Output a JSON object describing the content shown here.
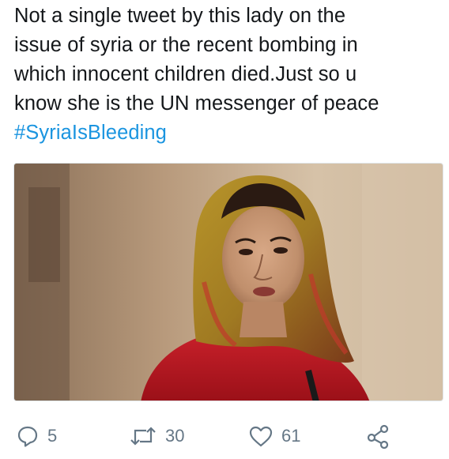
{
  "tweet": {
    "text_lines": [
      "Not a single tweet by this lady on the",
      "issue of syria or the recent bombing in",
      "which innocent children died.Just so u",
      "know she is the UN messenger of peace"
    ],
    "hashtag": "#SyriaIsBleeding"
  },
  "media": {
    "description_icon": "photo"
  },
  "actions": {
    "reply": {
      "icon": "reply-icon",
      "count": "5"
    },
    "retweet": {
      "icon": "retweet-icon",
      "count": "30"
    },
    "like": {
      "icon": "heart-icon",
      "count": "61"
    },
    "share": {
      "icon": "share-icon"
    }
  },
  "colors": {
    "text": "#14171a",
    "hashtag": "#1b95e0",
    "action": "#657786"
  }
}
